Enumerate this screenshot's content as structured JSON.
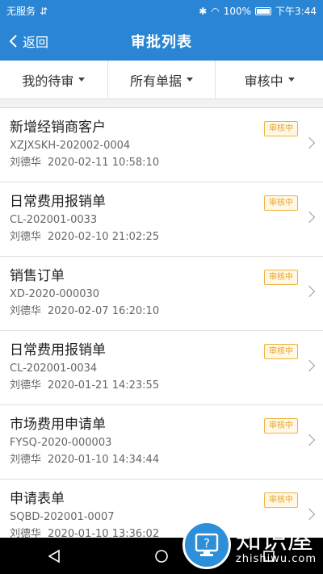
{
  "status_bar": {
    "carrier": "无服务",
    "battery": "100%",
    "time": "下午3:44"
  },
  "header": {
    "back_label": "返回",
    "title": "审批列表"
  },
  "filters": [
    {
      "label": "我的待审"
    },
    {
      "label": "所有单据"
    },
    {
      "label": "审核中"
    }
  ],
  "list": [
    {
      "title": "新增经销商客户",
      "code": "XZJXSKH-202002-0004",
      "user": "刘德华",
      "time": "2020-02-11 10:58:10",
      "status": "审核中"
    },
    {
      "title": "日常费用报销单",
      "code": "CL-202001-0033",
      "user": "刘德华",
      "time": "2020-02-10 21:02:25",
      "status": "审核中"
    },
    {
      "title": "销售订单",
      "code": "XD-2020-000030",
      "user": "刘德华",
      "time": "2020-02-07 16:20:10",
      "status": "审核中"
    },
    {
      "title": "日常费用报销单",
      "code": "CL-202001-0034",
      "user": "刘德华",
      "time": "2020-01-21 14:23:55",
      "status": "审核中"
    },
    {
      "title": "市场费用申请单",
      "code": "FYSQ-2020-000003",
      "user": "刘德华",
      "time": "2020-01-10 14:34:44",
      "status": "审核中"
    },
    {
      "title": "申请表单",
      "code": "SQBD-202001-0007",
      "user": "刘德华",
      "time": "2020-01-10 13:36:02",
      "status": "审核中"
    }
  ],
  "watermark": {
    "main": "知识屋",
    "sub": "zhishiwu.com"
  },
  "colors": {
    "primary": "#2a86d4",
    "badge": "#e8a326"
  }
}
